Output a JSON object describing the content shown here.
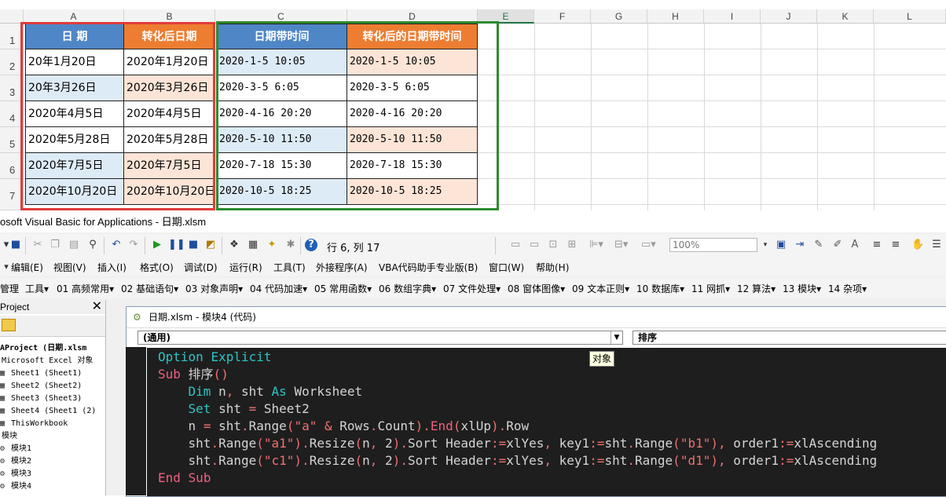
{
  "excel": {
    "columns": [
      "A",
      "B",
      "C",
      "D",
      "E",
      "F",
      "G",
      "H",
      "I",
      "J",
      "K",
      "L"
    ],
    "rows": [
      "1",
      "2",
      "3",
      "4",
      "5",
      "6",
      "7"
    ],
    "headers": [
      "日  期",
      "转化后日期",
      "日期带时间",
      "转化后的日期带时间"
    ],
    "table": [
      [
        "20年1月20日",
        "2020年1月20日",
        "2020-1-5 10:05",
        "2020-1-5 10:05"
      ],
      [
        "20年3月26日",
        "2020年3月26日",
        "2020-3-5 6:05",
        "2020-3-5 6:05"
      ],
      [
        "2020年4月5日",
        "2020年4月5日",
        "2020-4-16 20:20",
        "2020-4-16 20:20"
      ],
      [
        "2020年5月28日",
        "2020年5月28日",
        "2020-5-10 11:50",
        "2020-5-10 11:50"
      ],
      [
        "2020年7月5日",
        "2020年7月5日",
        "2020-7-18 15:30",
        "2020-7-18 15:30"
      ],
      [
        "2020年10月20日",
        "2020年10月20日",
        "2020-10-5 18:25",
        "2020-10-5 18:25"
      ]
    ],
    "colors": {
      "header_blue": "#4f86c6",
      "header_orange": "#ed7d31",
      "light_blue": "#ddebf7",
      "light_orange": "#fce4d6",
      "red_box": "#e03c3c",
      "green_box": "#2e8b2e"
    }
  },
  "vbe": {
    "title": "osoft Visual Basic for Applications - 日期.xlsm",
    "position": "行 6, 列 17",
    "zoom": "100%",
    "menus": [
      "编辑(E)",
      "视图(V)",
      "插入(I)",
      "格式(O)",
      "调试(D)",
      "运行(R)",
      "工具(T)",
      "外接程序(A)",
      "VBA代码助手专业版(B)",
      "窗口(W)",
      "帮助(H)"
    ],
    "toolbar2": [
      "管理",
      "工具▾",
      "01 高频常用▾",
      "02 基础语句▾",
      "03 对象声明▾",
      "04 代码加速▾",
      "05 常用函数▾",
      "06 数组字典▾",
      "07 文件处理▾",
      "08 窗体图像▾",
      "09 文本正则▾",
      "10 数据库▾",
      "11 网抓▾",
      "12 算法▾",
      "13 模块▾",
      "14 杂项▾"
    ],
    "project": {
      "title": "Project",
      "close": "✕",
      "tree": [
        "AProject (日期.xlsm",
        "Microsoft Excel 对象",
        "Sheet1 (Sheet1)",
        "Sheet2 (Sheet2)",
        "Sheet3 (Sheet3)",
        "Sheet4 (Sheet1 (2)",
        "ThisWorkbook",
        "模块",
        "模块1",
        "模块2",
        "模块3",
        "模块4"
      ]
    },
    "code_window": {
      "title": "日期.xlsm - 模块4 (代码)",
      "object_dropdown": "(通用)",
      "proc_dropdown": "排序",
      "tooltip": "对象",
      "lines": [
        "Option Explicit",
        "Sub 排序()",
        "    Dim n, sht As Worksheet",
        "    Set sht = Sheet2",
        "    n = sht.Range(\"a\" & Rows.Count).End(xlUp).Row",
        "    sht.Range(\"a1\").Resize(n, 2).Sort Header:=xlYes, key1:=sht.Range(\"b1\"), order1:=xlAscending",
        "    sht.Range(\"c1\").Resize(n, 2).Sort Header:=xlYes, key1:=sht.Range(\"d1\"), order1:=xlAscending",
        "End Sub"
      ]
    }
  }
}
